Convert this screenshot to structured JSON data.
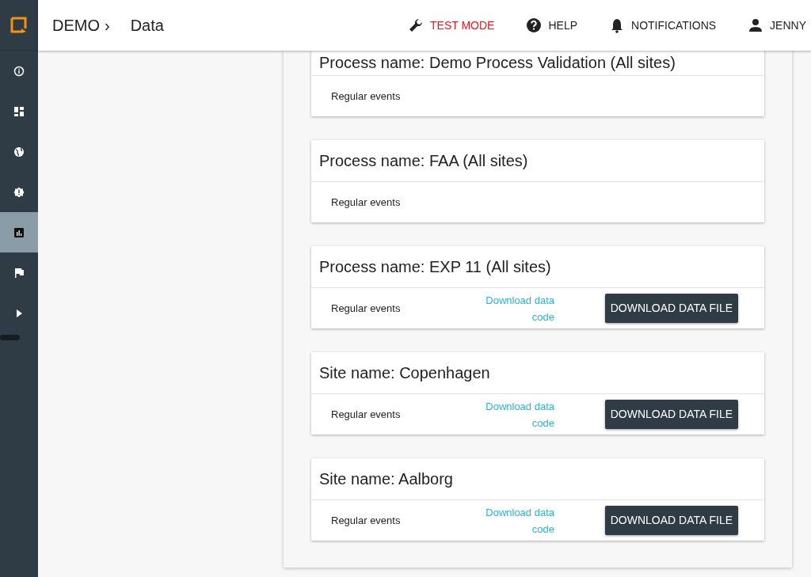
{
  "header": {
    "breadcrumb": [
      {
        "label": "DEMO",
        "separator": "›"
      },
      {
        "label": "Data"
      }
    ],
    "actions": [
      {
        "kind": "wrench",
        "label": "TEST MODE",
        "highlighted": true
      },
      {
        "kind": "help",
        "label": "HELP",
        "highlighted": false
      },
      {
        "kind": "bell",
        "label": "NOTIFICATIONS",
        "highlighted": false
      },
      {
        "kind": "person",
        "label": "JENNY",
        "highlighted": false
      }
    ]
  },
  "sidebar": {
    "items": [
      {
        "kind": "info",
        "selected": false
      },
      {
        "kind": "dashboard",
        "selected": false
      },
      {
        "kind": "globe",
        "selected": false
      },
      {
        "kind": "alert",
        "selected": false
      },
      {
        "kind": "chart",
        "selected": true
      },
      {
        "kind": "flag",
        "selected": false
      },
      {
        "kind": "play",
        "selected": false
      }
    ]
  },
  "cards": [
    {
      "title": "Process name: Demo Process Validation (All sites)",
      "event_type": "Regular events"
    },
    {
      "title": "Process name: FAA (All sites)",
      "event_type": "Regular events"
    },
    {
      "title": "Process name: EXP 11 (All sites)",
      "event_type": "Regular events",
      "link": "Download data code",
      "button": "DOWNLOAD DATA FILE"
    },
    {
      "title": "Site name: Copenhagen",
      "event_type": "Regular events",
      "link": "Download data code",
      "button": "DOWNLOAD DATA FILE"
    },
    {
      "title": "Site name: Aalborg",
      "event_type": "Regular events",
      "link": "Download data code",
      "button": "DOWNLOAD DATA FILE"
    }
  ]
}
